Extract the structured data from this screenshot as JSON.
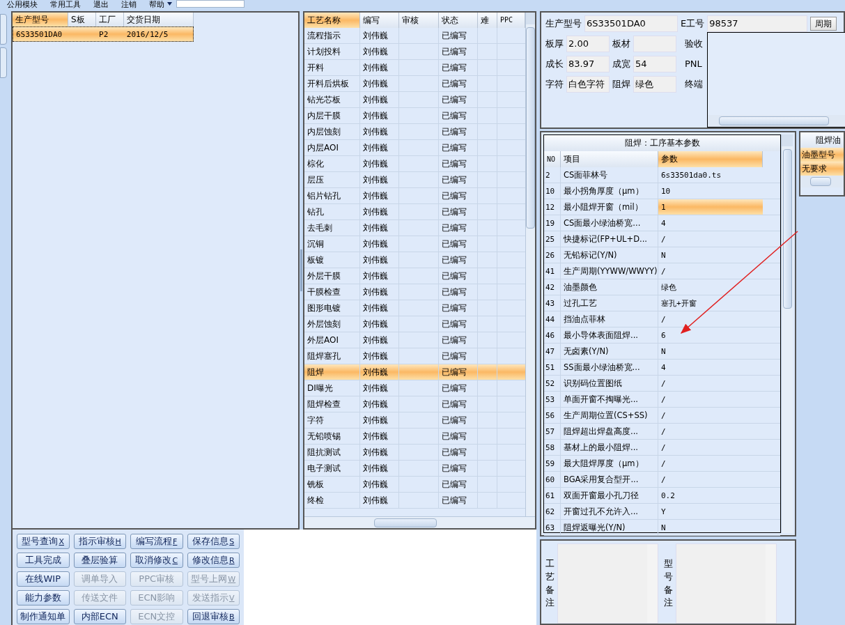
{
  "menu": {
    "items": [
      "公用模块",
      "常用工具",
      "退出",
      "注销",
      "帮助"
    ]
  },
  "order_table": {
    "columns": [
      "生产型号",
      "S板",
      "工厂",
      "交货日期"
    ],
    "rows": [
      {
        "cells": [
          "6S33501DA0",
          "",
          "P2",
          "2016/12/5"
        ],
        "selected": true
      }
    ]
  },
  "process_table": {
    "columns": [
      "工艺名称",
      "编写",
      "审核",
      "状态",
      "难",
      "PPC"
    ],
    "rows": [
      {
        "name": "流程指示",
        "writer": "刘伟巍",
        "status": "已编写",
        "selected": false
      },
      {
        "name": "计划投料",
        "writer": "刘伟巍",
        "status": "已编写",
        "selected": false
      },
      {
        "name": "开料",
        "writer": "刘伟巍",
        "status": "已编写",
        "selected": false
      },
      {
        "name": "开料后烘板",
        "writer": "刘伟巍",
        "status": "已编写",
        "selected": false
      },
      {
        "name": "钻光芯板",
        "writer": "刘伟巍",
        "status": "已编写",
        "selected": false
      },
      {
        "name": "内层干膜",
        "writer": "刘伟巍",
        "status": "已编写",
        "selected": false
      },
      {
        "name": "内层蚀刻",
        "writer": "刘伟巍",
        "status": "已编写",
        "selected": false
      },
      {
        "name": "内层AOI",
        "writer": "刘伟巍",
        "status": "已编写",
        "selected": false
      },
      {
        "name": "棕化",
        "writer": "刘伟巍",
        "status": "已编写",
        "selected": false
      },
      {
        "name": "层压",
        "writer": "刘伟巍",
        "status": "已编写",
        "selected": false
      },
      {
        "name": "铝片钻孔",
        "writer": "刘伟巍",
        "status": "已编写",
        "selected": false
      },
      {
        "name": "钻孔",
        "writer": "刘伟巍",
        "status": "已编写",
        "selected": false
      },
      {
        "name": "去毛刺",
        "writer": "刘伟巍",
        "status": "已编写",
        "selected": false
      },
      {
        "name": "沉铜",
        "writer": "刘伟巍",
        "status": "已编写",
        "selected": false
      },
      {
        "name": "板镀",
        "writer": "刘伟巍",
        "status": "已编写",
        "selected": false
      },
      {
        "name": "外层干膜",
        "writer": "刘伟巍",
        "status": "已编写",
        "selected": false
      },
      {
        "name": "干膜检查",
        "writer": "刘伟巍",
        "status": "已编写",
        "selected": false
      },
      {
        "name": "图形电镀",
        "writer": "刘伟巍",
        "status": "已编写",
        "selected": false
      },
      {
        "name": "外层蚀刻",
        "writer": "刘伟巍",
        "status": "已编写",
        "selected": false
      },
      {
        "name": "外层AOI",
        "writer": "刘伟巍",
        "status": "已编写",
        "selected": false
      },
      {
        "name": "阻焊塞孔",
        "writer": "刘伟巍",
        "status": "已编写",
        "selected": false
      },
      {
        "name": "阻焊",
        "writer": "刘伟巍",
        "status": "已编写",
        "selected": true
      },
      {
        "name": "DI曝光",
        "writer": "刘伟巍",
        "status": "已编写",
        "selected": false
      },
      {
        "name": "阻焊检查",
        "writer": "刘伟巍",
        "status": "已编写",
        "selected": false
      },
      {
        "name": "字符",
        "writer": "刘伟巍",
        "status": "已编写",
        "selected": false
      },
      {
        "name": "无铅喷锡",
        "writer": "刘伟巍",
        "status": "已编写",
        "selected": false
      },
      {
        "name": "阻抗测试",
        "writer": "刘伟巍",
        "status": "已编写",
        "selected": false
      },
      {
        "name": "电子测试",
        "writer": "刘伟巍",
        "status": "已编写",
        "selected": false
      },
      {
        "name": "铣板",
        "writer": "刘伟巍",
        "status": "已编写",
        "selected": false
      },
      {
        "name": "终检",
        "writer": "刘伟巍",
        "status": "已编写",
        "selected": false
      }
    ]
  },
  "buttons": [
    {
      "label": "型号查询",
      "shortcut": "X",
      "disabled": false
    },
    {
      "label": "指示审核",
      "shortcut": "H",
      "disabled": false
    },
    {
      "label": "编写流程",
      "shortcut": "F",
      "disabled": false
    },
    {
      "label": "保存信息",
      "shortcut": "S",
      "disabled": false
    },
    {
      "label": "工具完成",
      "disabled": false
    },
    {
      "label": "叠层验算",
      "disabled": false
    },
    {
      "label": "取消修改",
      "shortcut": "C",
      "disabled": false
    },
    {
      "label": "修改信息",
      "shortcut": "R",
      "disabled": false
    },
    {
      "label": "在线WIP",
      "disabled": false
    },
    {
      "label": "调单导入",
      "disabled": true
    },
    {
      "label": "PPC审核",
      "disabled": true
    },
    {
      "label": "型号上网",
      "shortcut": "W",
      "disabled": true
    },
    {
      "label": "能力参数",
      "disabled": false
    },
    {
      "label": "传送文件",
      "disabled": true
    },
    {
      "label": "ECN影响",
      "disabled": true
    },
    {
      "label": "发送指示",
      "shortcut": "V",
      "disabled": true
    },
    {
      "label": "制作通知单",
      "disabled": false
    },
    {
      "label": "内部ECN",
      "disabled": false
    },
    {
      "label": "ECN文控",
      "disabled": true
    },
    {
      "label": "回退审核",
      "shortcut": "B",
      "disabled": false
    }
  ],
  "info": {
    "top": [
      {
        "kind": "field",
        "label": "生产型号",
        "value": "6S33501DA0"
      },
      {
        "kind": "field",
        "label": "E工号",
        "value": "98537"
      },
      {
        "kind": "button",
        "label": "周期"
      }
    ],
    "rows": [
      [
        {
          "kind": "field",
          "label": "板厚",
          "value": "2.00"
        },
        {
          "kind": "field",
          "label": "板材"
        },
        {
          "kind": "label",
          "label": "验收"
        }
      ],
      [
        {
          "kind": "field",
          "label": "成长",
          "value": "83.97"
        },
        {
          "kind": "field",
          "label": "成宽",
          "value": "54"
        },
        {
          "kind": "label",
          "label": "PNL"
        }
      ],
      [
        {
          "kind": "field",
          "label": "字符",
          "value": "白色字符"
        },
        {
          "kind": "field",
          "label": "阻焊",
          "value": "绿色"
        },
        {
          "kind": "label",
          "label": "终端"
        }
      ]
    ]
  },
  "param_table": {
    "title": "阻焊：工序基本参数",
    "columns": [
      "NO",
      "项目",
      "参数"
    ],
    "rows": [
      {
        "no": "2",
        "item": "CS面菲林号",
        "value": "6s33501da0.ts",
        "selected": false
      },
      {
        "no": "10",
        "item": "最小拐角厚度（μm）",
        "value": "10",
        "selected": false
      },
      {
        "no": "12",
        "item": "最小阻焊开窗（mil）",
        "value": "1",
        "selected": true
      },
      {
        "no": "19",
        "item": "CS面最小绿油桥宽...",
        "value": "4",
        "selected": false
      },
      {
        "no": "25",
        "item": "快捷标记(FP+UL+D...",
        "value": "/",
        "selected": false
      },
      {
        "no": "26",
        "item": "无铅标记(Y/N)",
        "value": "N",
        "selected": false
      },
      {
        "no": "41",
        "item": "生产周期(YYWW/WWYY)",
        "value": "/",
        "selected": false
      },
      {
        "no": "42",
        "item": "油墨颜色",
        "value": "绿色",
        "selected": false
      },
      {
        "no": "43",
        "item": "过孔工艺",
        "value": "塞孔+开窗",
        "selected": false
      },
      {
        "no": "44",
        "item": "挡油点菲林",
        "value": "/",
        "selected": false
      },
      {
        "no": "46",
        "item": "最小导体表面阻焊...",
        "value": "6",
        "selected": false
      },
      {
        "no": "47",
        "item": "无卤素(Y/N)",
        "value": "N",
        "selected": false
      },
      {
        "no": "51",
        "item": "SS面最小绿油桥宽...",
        "value": "4",
        "selected": false
      },
      {
        "no": "52",
        "item": "识别码位置图纸",
        "value": "/",
        "selected": false
      },
      {
        "no": "53",
        "item": "单面开窗不掏曝光...",
        "value": "/",
        "selected": false
      },
      {
        "no": "56",
        "item": "生产周期位置(CS+SS)",
        "value": "/",
        "selected": false
      },
      {
        "no": "57",
        "item": "阻焊超出焊盘高度...",
        "value": "/",
        "selected": false
      },
      {
        "no": "58",
        "item": "基材上的最小阻焊...",
        "value": "/",
        "selected": false
      },
      {
        "no": "59",
        "item": "最大阻焊厚度（μm）",
        "value": "/",
        "selected": false
      },
      {
        "no": "60",
        "item": "BGA采用复合型开...",
        "value": "/",
        "selected": false
      },
      {
        "no": "61",
        "item": "双面开窗最小孔刀径",
        "value": "0.2",
        "selected": false
      },
      {
        "no": "62",
        "item": "开窗过孔不允许入...",
        "value": "Y",
        "selected": false
      },
      {
        "no": "63",
        "item": "阻焊返曝光(Y/N)",
        "value": "N",
        "selected": false
      }
    ]
  },
  "ink_panel": {
    "title": "阻焊油",
    "columns": [
      "油墨型号"
    ],
    "rows": [
      "无要求"
    ]
  },
  "notes": [
    {
      "label": "工艺备注"
    },
    {
      "label": "型号备注"
    }
  ]
}
